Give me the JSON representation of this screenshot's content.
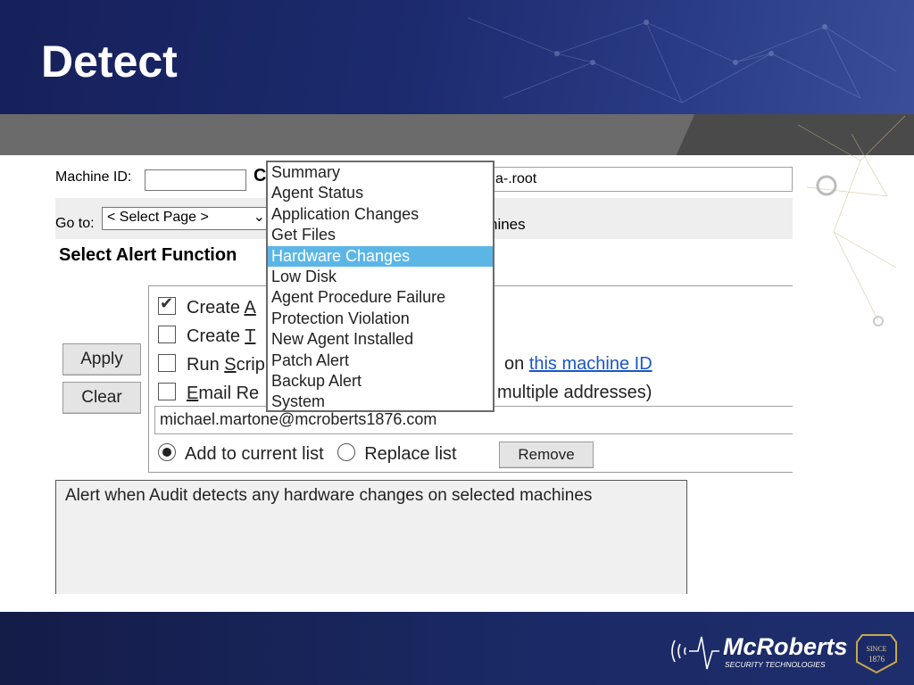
{
  "slide": {
    "title": "Detect"
  },
  "screenshot": {
    "machine_id_label": "Machine ID:",
    "machine_id_value": "",
    "partial_label": "C",
    "group_id_value": "a-.root",
    "goto_label": "Go to:",
    "goto_select_value": "< Select Page >",
    "machines_label_fragment": "hines",
    "select_alert_heading": "Select Alert Function",
    "apply_button": "Apply",
    "clear_button": "Clear",
    "options": [
      {
        "checked": true,
        "lead": "Create ",
        "key": "A"
      },
      {
        "checked": false,
        "lead": "Create ",
        "key": "T"
      },
      {
        "checked": false,
        "lead": "Run ",
        "key": "S",
        "tail": "crip"
      },
      {
        "checked": false,
        "lead": "",
        "key": "E",
        "tail": "mail Re"
      }
    ],
    "run_script_suffix": "on",
    "run_script_link": "this machine ID",
    "email_suffix": "multiple addresses)",
    "email_value": "michael.martone@mcroberts1876.com",
    "radio_add": "Add to current list",
    "radio_replace": "Replace list",
    "radio_selected": "add",
    "remove_button": "Remove",
    "description": "Alert when Audit detects any hardware changes on selected machines"
  },
  "dropdown": {
    "items": [
      "Summary",
      "Agent Status",
      "Application Changes",
      "Get Files",
      "Hardware Changes",
      "Low Disk",
      "Agent Procedure Failure",
      "Protection Violation",
      "New Agent Installed",
      "Patch Alert",
      "Backup Alert",
      "System"
    ],
    "selected": "Hardware Changes"
  },
  "logo": {
    "brand": "McRoberts",
    "tagline": "SECURITY TECHNOLOGIES",
    "seal_line1": "SINCE",
    "seal_line2": "1876"
  },
  "colors": {
    "header_navy": "#1c2b6e",
    "highlight": "#5bb6e6",
    "link": "#1a56c8"
  }
}
